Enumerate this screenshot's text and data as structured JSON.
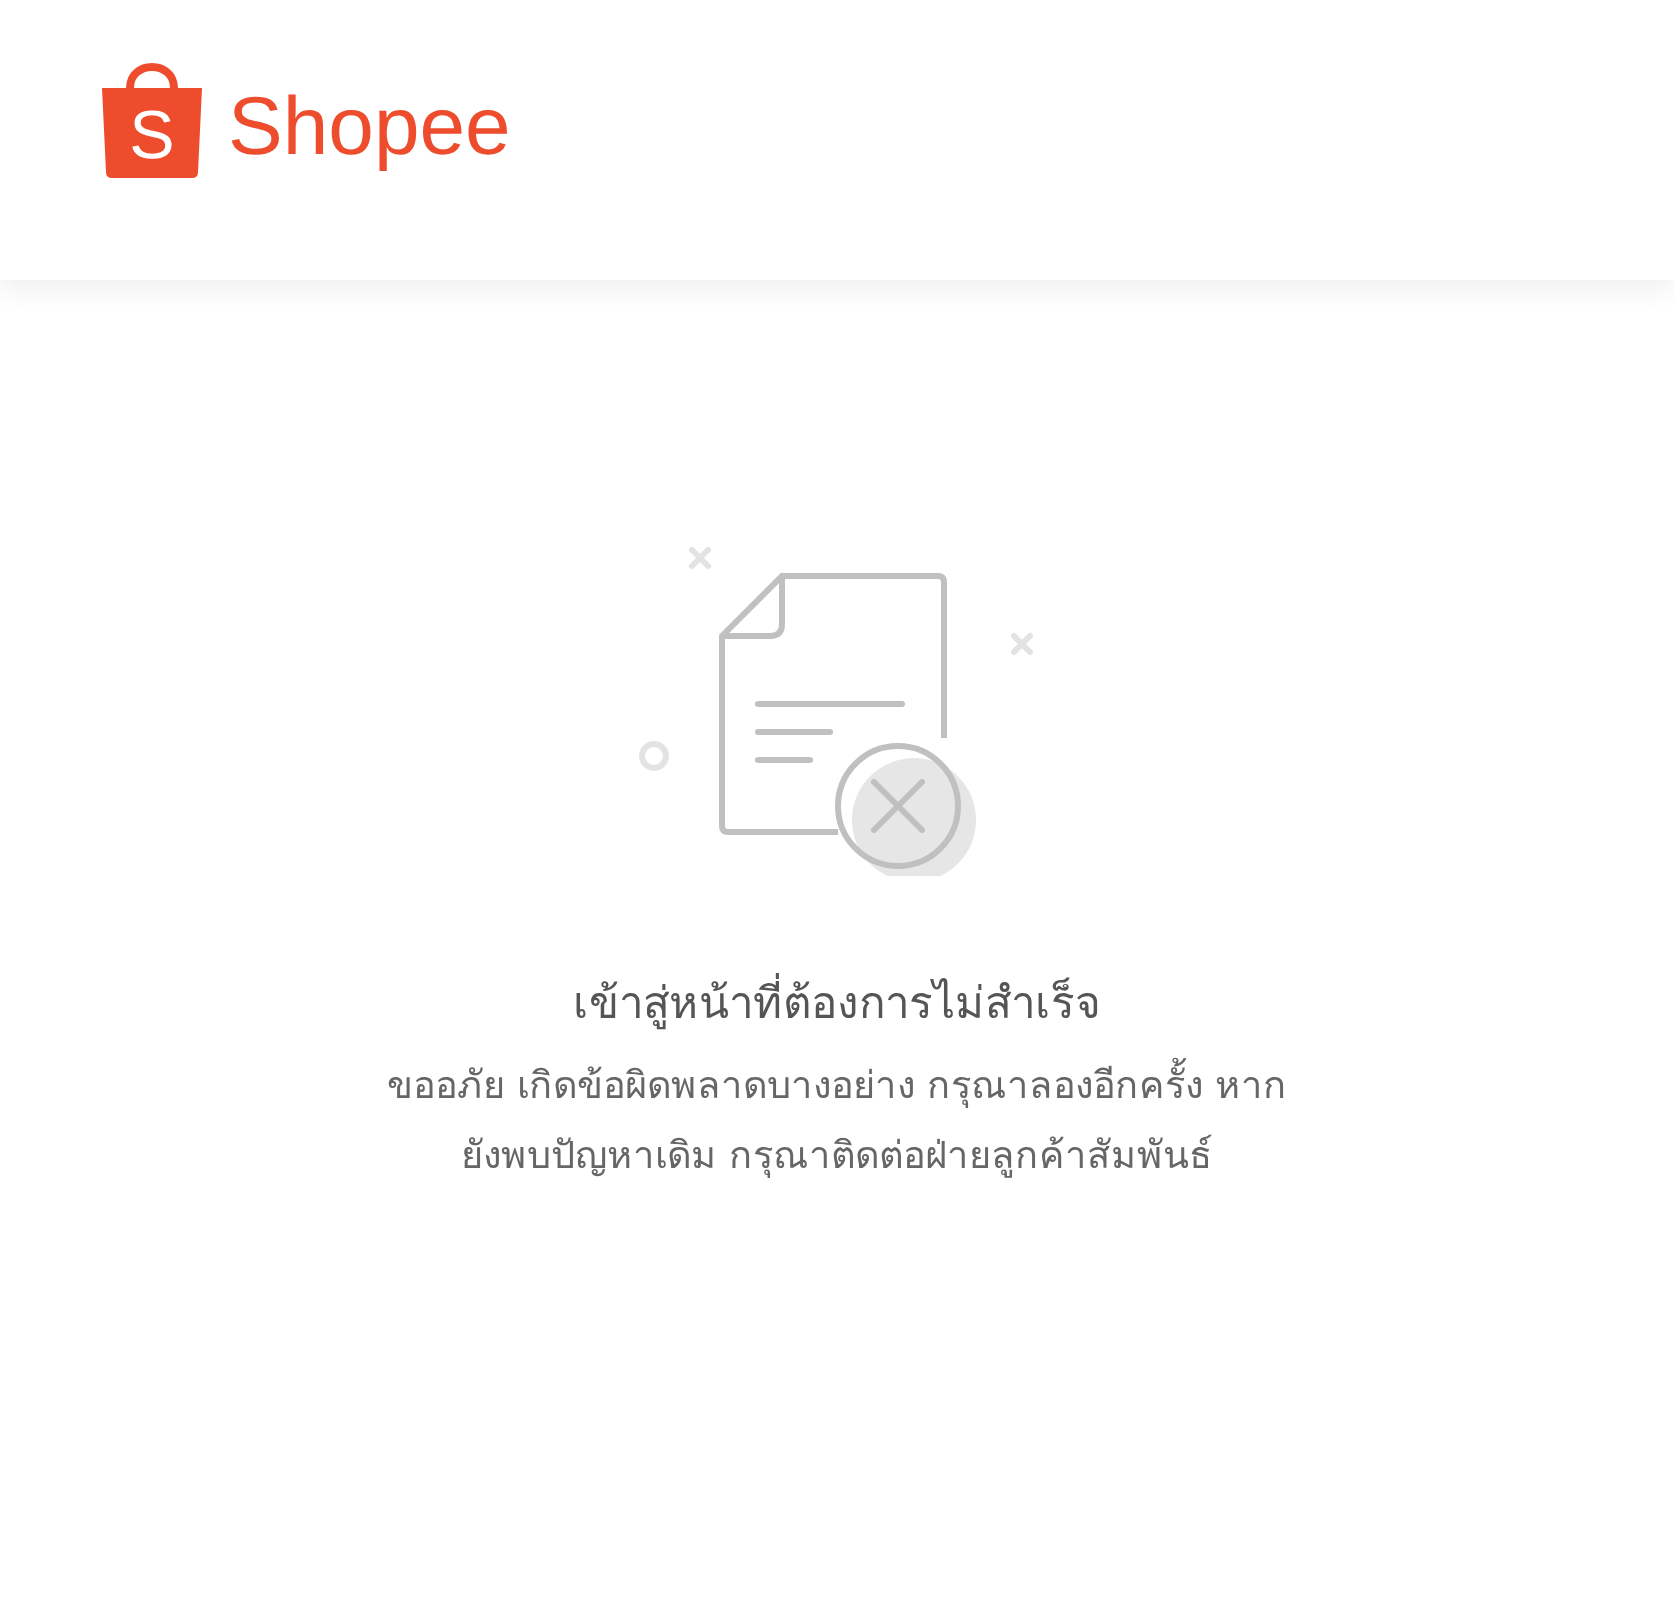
{
  "header": {
    "logo": {
      "mark": "S",
      "wordmark": "Shopee"
    }
  },
  "error": {
    "title": "เข้าสู่หน้าที่ต้องการไม่สำเร็จ",
    "message_lines": [
      "ขออภัย เกิดข้อผิดพลาดบางอย่าง กรุณาลองอีกครั้ง หาก",
      "ยังพบปัญหาเดิม กรุณาติดต่อฝ่ายลูกค้าสัมพันธ์"
    ]
  }
}
